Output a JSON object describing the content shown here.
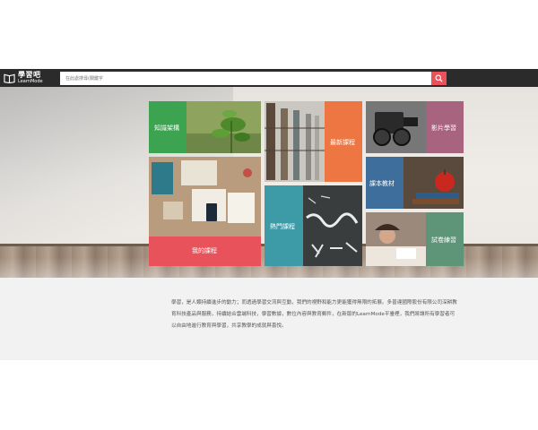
{
  "header": {
    "logo_text": "學習吧",
    "logo_sub": "LearnMode",
    "search_placeholder": "在此處搜尋(關鍵字"
  },
  "tiles": {
    "knowledge": "知識架構",
    "latest": "最新課程",
    "video": "影片學習",
    "textbook": "課本教材",
    "mine": "我的課程",
    "popular": "熱門課程",
    "exam": "試卷練習"
  },
  "intro": {
    "paragraph": "學習，是人類持續進步的動力；而透過學習交流與互動，我們的視野和能力更能獲得無限的拓展。多普達國際股份有限公司深耕教育科技產品與服務，持續結合雲端科技，學習數據，數位內容與教育郵件，在新版的LearnMode平臺裡，我們將讓所有學習者可以自由地進行教育與學習，共享教學的成就與喜悅。"
  },
  "colors": {
    "green": "#3ca350",
    "orange": "#ee7643",
    "mauve": "#a8637e",
    "blue": "#3e6e9b",
    "red": "#e8525a",
    "teal": "#3d9aa7",
    "sage": "#5e9578"
  }
}
